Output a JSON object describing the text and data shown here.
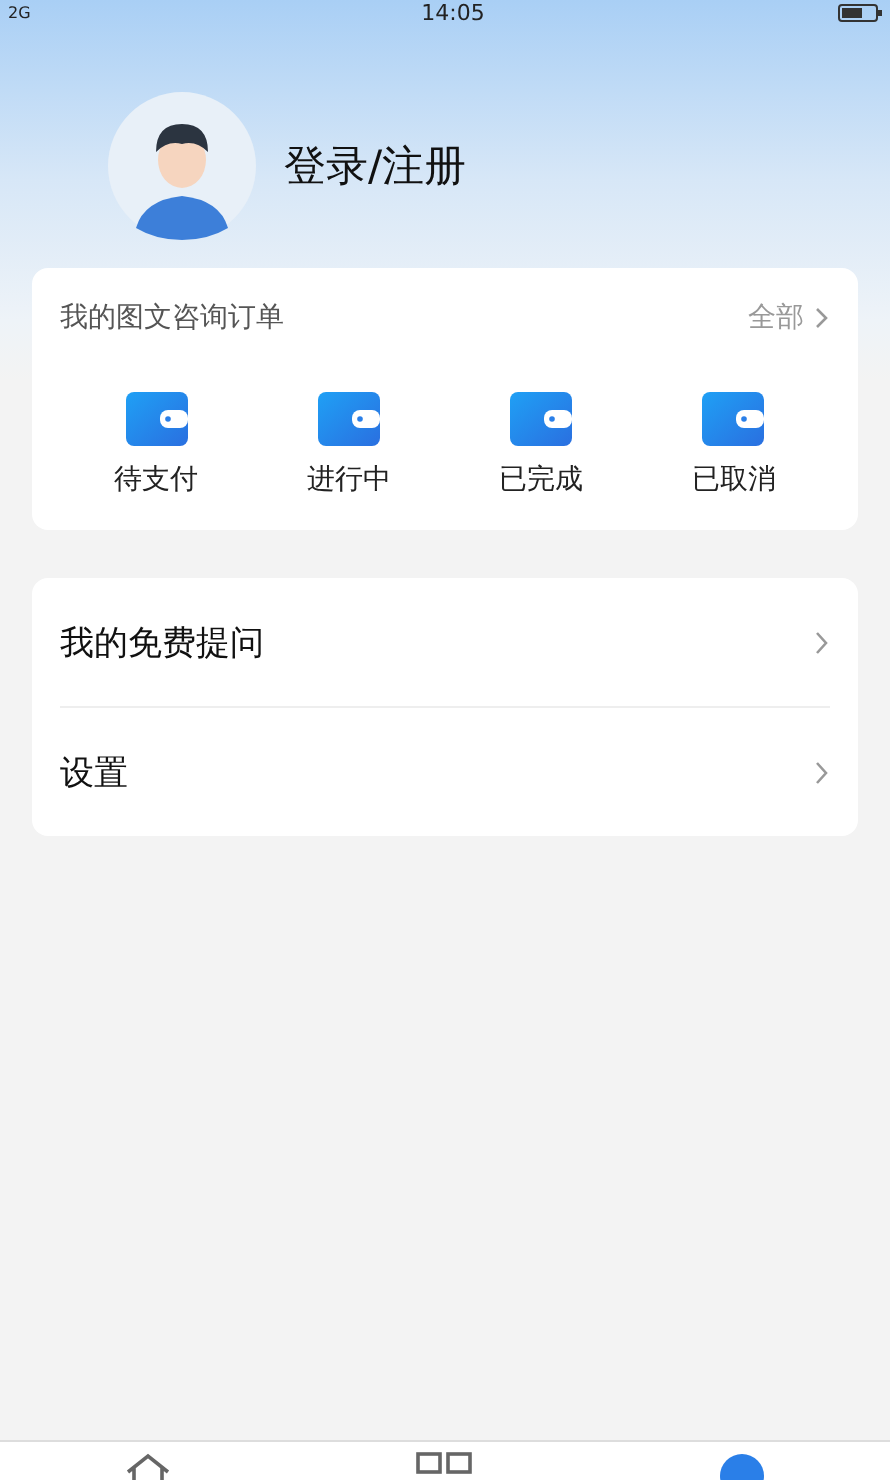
{
  "status_bar": {
    "signal": "2G",
    "time": "14:05"
  },
  "profile": {
    "login_label": "登录/注册"
  },
  "orders": {
    "title": "我的图文咨询订单",
    "all_link": "全部",
    "items": [
      {
        "label": "待支付"
      },
      {
        "label": "进行中"
      },
      {
        "label": "已完成"
      },
      {
        "label": "已取消"
      }
    ]
  },
  "menu": [
    {
      "label": "我的免费提问"
    },
    {
      "label": "设置"
    }
  ],
  "tab_bar": [
    {
      "kind": "home",
      "selected": false
    },
    {
      "kind": "grid",
      "selected": false
    },
    {
      "kind": "profile",
      "selected": true
    }
  ]
}
